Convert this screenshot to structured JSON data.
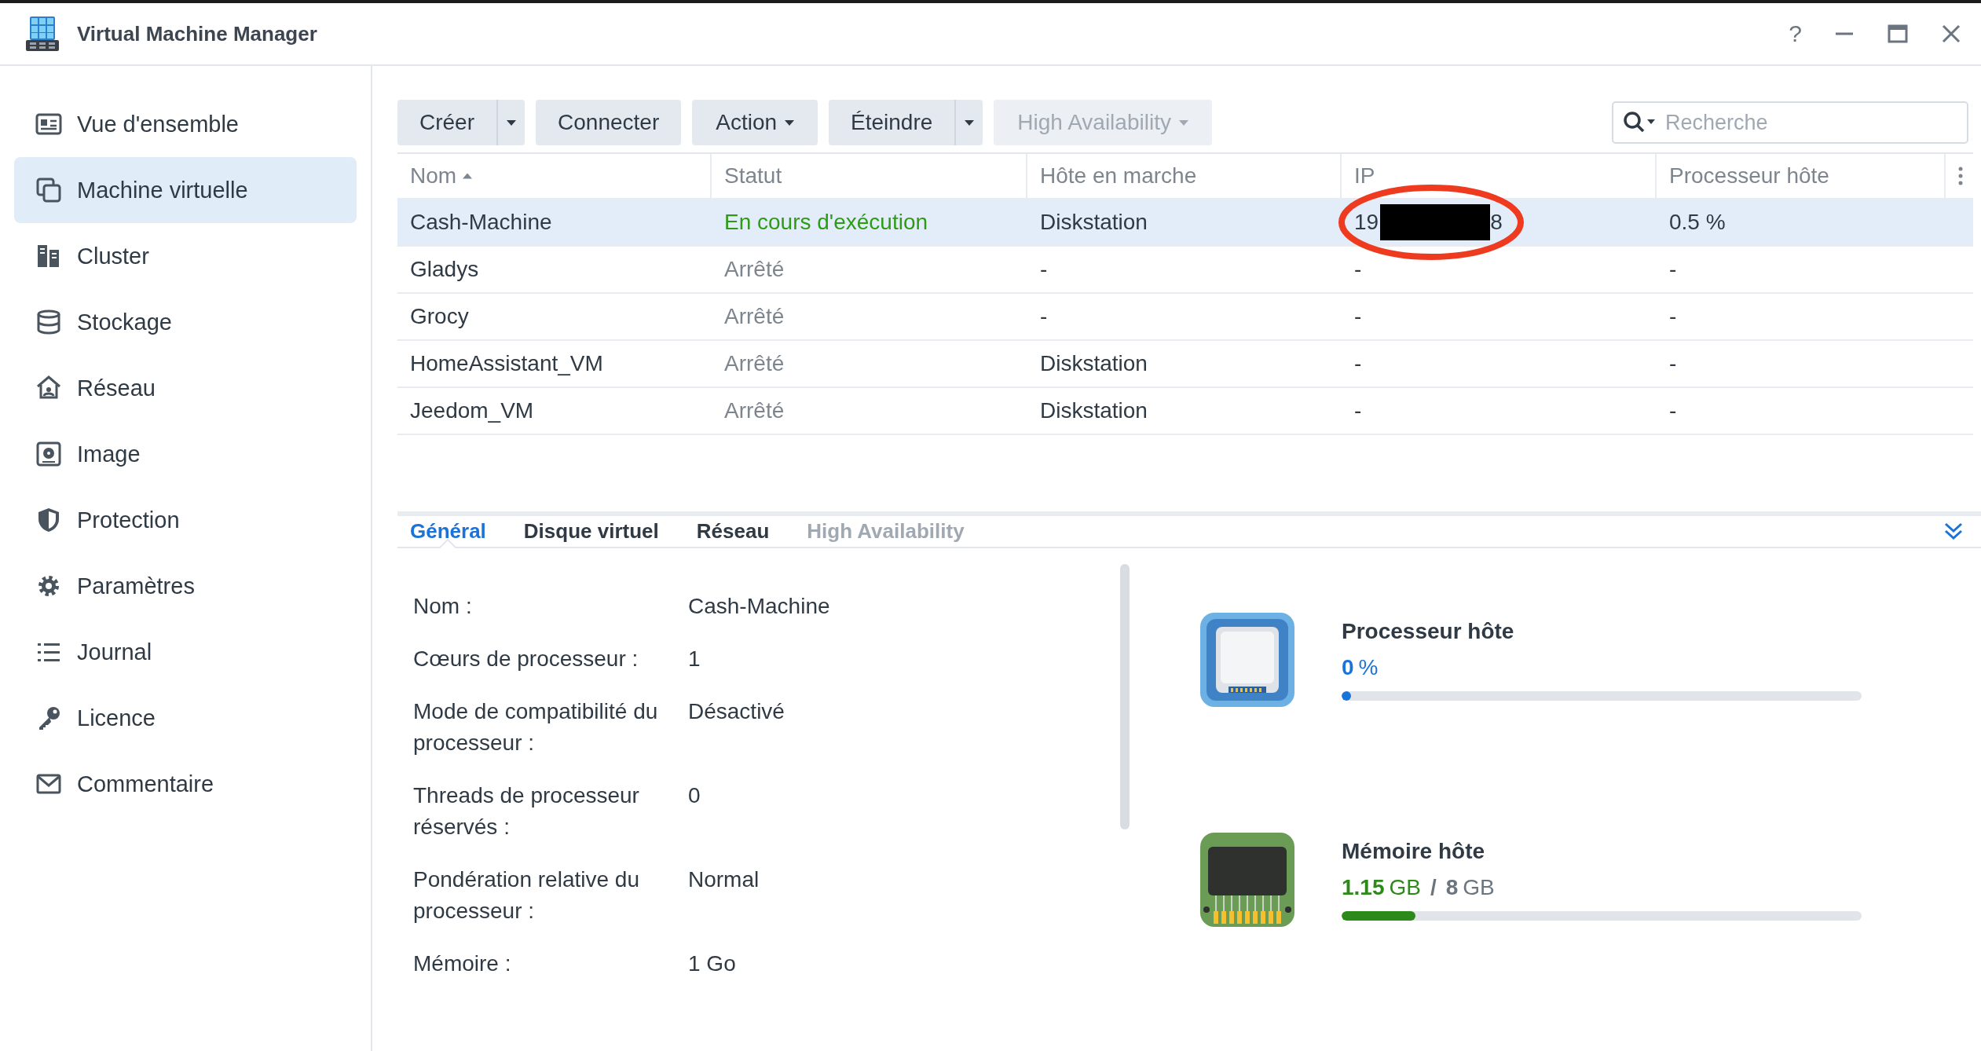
{
  "window": {
    "title": "Virtual Machine Manager",
    "controls": [
      "?"
    ]
  },
  "sidebar": {
    "items": [
      {
        "label": "Vue d'ensemble",
        "selected": false
      },
      {
        "label": "Machine virtuelle",
        "selected": true
      },
      {
        "label": "Cluster",
        "selected": false
      },
      {
        "label": "Stockage",
        "selected": false
      },
      {
        "label": "Réseau",
        "selected": false
      },
      {
        "label": "Image",
        "selected": false
      },
      {
        "label": "Protection",
        "selected": false
      },
      {
        "label": "Paramètres",
        "selected": false
      },
      {
        "label": "Journal",
        "selected": false
      },
      {
        "label": "Licence",
        "selected": false
      },
      {
        "label": "Commentaire",
        "selected": false
      }
    ]
  },
  "toolbar": {
    "buttons": [
      {
        "label": "Créer",
        "kind": "split",
        "disabled": false
      },
      {
        "label": "Connecter",
        "kind": "plain",
        "disabled": false
      },
      {
        "label": "Action",
        "kind": "menu",
        "disabled": false
      },
      {
        "label": "Éteindre",
        "kind": "split",
        "disabled": false
      },
      {
        "label": "High Availability",
        "kind": "menu",
        "disabled": true
      }
    ],
    "search": {
      "placeholder": "Recherche"
    }
  },
  "table": {
    "columns": [
      {
        "label": "Nom",
        "sorted": true
      },
      {
        "label": "Statut",
        "sorted": false
      },
      {
        "label": "Hôte en marche",
        "sorted": false
      },
      {
        "label": "IP",
        "sorted": false
      },
      {
        "label": "Processeur hôte",
        "sorted": false
      }
    ],
    "rows": [
      {
        "selected": true,
        "name": "Cash-Machine",
        "status": "En cours d'exécution",
        "running": true,
        "host": "Diskstation",
        "ip": {
          "start": "19",
          "end": "8",
          "redacted": true,
          "circled": true
        },
        "cpu": "0.5 %"
      },
      {
        "selected": false,
        "name": "Gladys",
        "status": "Arrêté",
        "running": false,
        "host": "-",
        "ip": {
          "start": "-"
        },
        "cpu": "-"
      },
      {
        "selected": false,
        "name": "Grocy",
        "status": "Arrêté",
        "running": false,
        "host": "-",
        "ip": {
          "start": "-"
        },
        "cpu": "-"
      },
      {
        "selected": false,
        "name": "HomeAssistant_VM",
        "status": "Arrêté",
        "running": false,
        "host": "Diskstation",
        "ip": {
          "start": "-"
        },
        "cpu": "-"
      },
      {
        "selected": false,
        "name": "Jeedom_VM",
        "status": "Arrêté",
        "running": false,
        "host": "Diskstation",
        "ip": {
          "start": "-"
        },
        "cpu": "-"
      }
    ]
  },
  "details": {
    "tabs": [
      {
        "label": "Général",
        "selected": true,
        "disabled": false
      },
      {
        "label": "Disque virtuel",
        "selected": false,
        "disabled": false
      },
      {
        "label": "Réseau",
        "selected": false,
        "disabled": false
      },
      {
        "label": "High Availability",
        "selected": false,
        "disabled": true
      }
    ],
    "fields": [
      {
        "label": "Nom :",
        "value": "Cash-Machine"
      },
      {
        "label": "Cœurs de processeur :",
        "value": "1"
      },
      {
        "label": "Mode de compatibilité du processeur :",
        "value": "Désactivé"
      },
      {
        "label": "Threads de processeur réservés :",
        "value": "0"
      },
      {
        "label": "Pondération relative du processeur :",
        "value": "Normal"
      },
      {
        "label": "Mémoire :",
        "value": "1 Go"
      }
    ],
    "meters": [
      {
        "kind": "cpu",
        "title": "Processeur hôte",
        "used": "0",
        "used_unit": "%",
        "level": 0.018
      },
      {
        "kind": "memory",
        "title": "Mémoire hôte",
        "used": "1.15",
        "used_unit": "GB",
        "sep": "/",
        "total": "8",
        "total_unit": "GB",
        "level": 0.142
      }
    ]
  }
}
